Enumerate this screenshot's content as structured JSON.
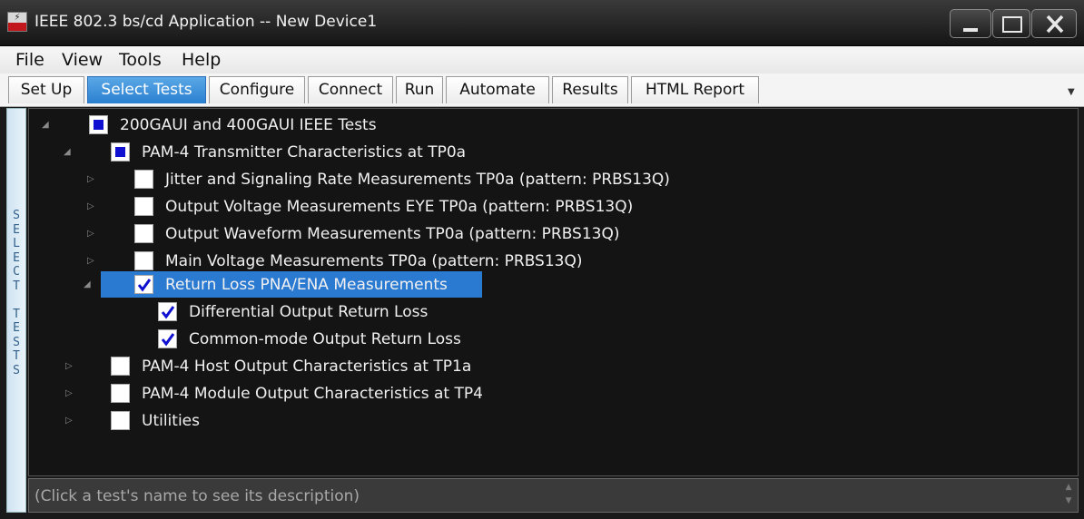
{
  "window": {
    "title": "IEEE 802.3 bs/cd Application -- New Device1"
  },
  "menu": [
    "File",
    "View",
    "Tools",
    "Help"
  ],
  "tabs": [
    "Set Up",
    "Select Tests",
    "Configure",
    "Connect",
    "Run",
    "Automate",
    "Results",
    "HTML Report"
  ],
  "active_tab": "Select Tests",
  "side_label": "SELECT TESTS",
  "tree": [
    {
      "label": "200GAUI and 400GAUI IEEE Tests",
      "state": "partial",
      "expanded": true
    },
    {
      "label": "PAM-4 Transmitter Characteristics at TP0a",
      "state": "partial",
      "expanded": true
    },
    {
      "label": "Jitter and Signaling Rate Measurements TP0a (pattern: PRBS13Q)",
      "state": "unchecked",
      "expanded": false
    },
    {
      "label": "Output Voltage Measurements EYE TP0a (pattern: PRBS13Q)",
      "state": "unchecked",
      "expanded": false
    },
    {
      "label": "Output Waveform Measurements TP0a (pattern: PRBS13Q)",
      "state": "unchecked",
      "expanded": false
    },
    {
      "label": "Main Voltage Measurements TP0a (pattern: PRBS13Q)",
      "state": "unchecked",
      "expanded": false
    },
    {
      "label": "Return Loss PNA/ENA Measurements",
      "state": "checked",
      "expanded": true,
      "selected": true
    },
    {
      "label": "Differential Output Return Loss",
      "state": "checked"
    },
    {
      "label": "Common-mode Output Return Loss",
      "state": "checked"
    },
    {
      "label": "PAM-4 Host Output Characteristics at TP1a",
      "state": "unchecked",
      "expanded": false
    },
    {
      "label": "PAM-4 Module Output Characteristics at TP4",
      "state": "unchecked",
      "expanded": false
    },
    {
      "label": "Utilities",
      "state": "unchecked",
      "expanded": false
    }
  ],
  "description": "(Click a test's name to see its description)",
  "colors": {
    "selection": "#2b7ad2",
    "active_tab": "#2a7fd0",
    "checkbox_fill": "#1010d0"
  }
}
